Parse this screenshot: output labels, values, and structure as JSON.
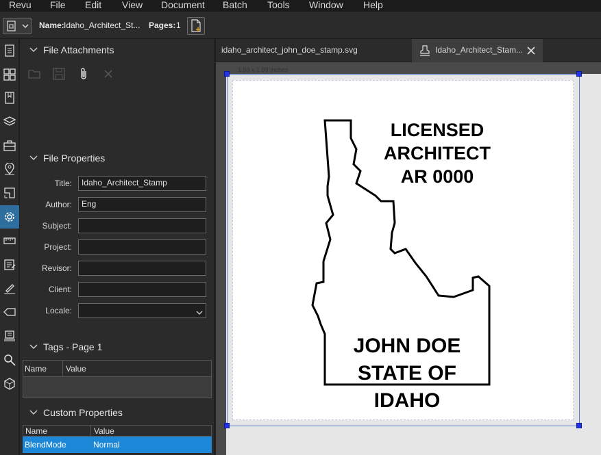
{
  "menu": [
    "Revu",
    "File",
    "Edit",
    "View",
    "Document",
    "Batch",
    "Tools",
    "Window",
    "Help"
  ],
  "toolbar": {
    "name_label": "Name:",
    "name_value": "Idaho_Architect_St...",
    "pages_label": "Pages:",
    "pages_value": "1"
  },
  "sidebar_icons": [
    "thumbnails-icon",
    "grid-icon",
    "bookmarks-icon",
    "layers-icon",
    "toolchest-icon",
    "places-icon",
    "spaces-icon",
    "properties-gear-icon",
    "measurements-icon",
    "markups-list-icon",
    "signatures-icon",
    "tags-icon",
    "batch-icon",
    "search-icon",
    "3d-icon"
  ],
  "file_attachments": {
    "title": "File Attachments"
  },
  "file_properties": {
    "title": "File Properties",
    "fields": [
      {
        "label": "Title:",
        "value": "Idaho_Architect_Stamp"
      },
      {
        "label": "Author:",
        "value": "Eng"
      },
      {
        "label": "Subject:",
        "value": ""
      },
      {
        "label": "Project:",
        "value": ""
      },
      {
        "label": "Revisor:",
        "value": ""
      },
      {
        "label": "Client:",
        "value": ""
      },
      {
        "label": "Locale:",
        "value": ""
      }
    ]
  },
  "tags": {
    "title": "Tags - Page 1",
    "columns": [
      "Name",
      "Value"
    ]
  },
  "custom_properties": {
    "title": "Custom Properties",
    "columns": [
      "Name",
      "Value"
    ],
    "rows": [
      {
        "name": "BlendMode",
        "value": "Normal"
      }
    ]
  },
  "tabs": [
    {
      "label": "idaho_architect_john_doe_stamp.svg",
      "active": false
    },
    {
      "label": "Idaho_Architect_Stam...",
      "active": true
    }
  ],
  "canvas": {
    "dimension_label": "1.99 x 1.99 Inches",
    "stamp_lines_top": [
      "LICENSED",
      "ARCHITECT",
      "AR 0000"
    ],
    "stamp_lines_bottom": [
      "JOHN DOE",
      "STATE OF IDAHO"
    ]
  },
  "colors": {
    "accent": "#2f6f9f",
    "selection_row": "#1e88d8",
    "handle": "#2133e6"
  }
}
